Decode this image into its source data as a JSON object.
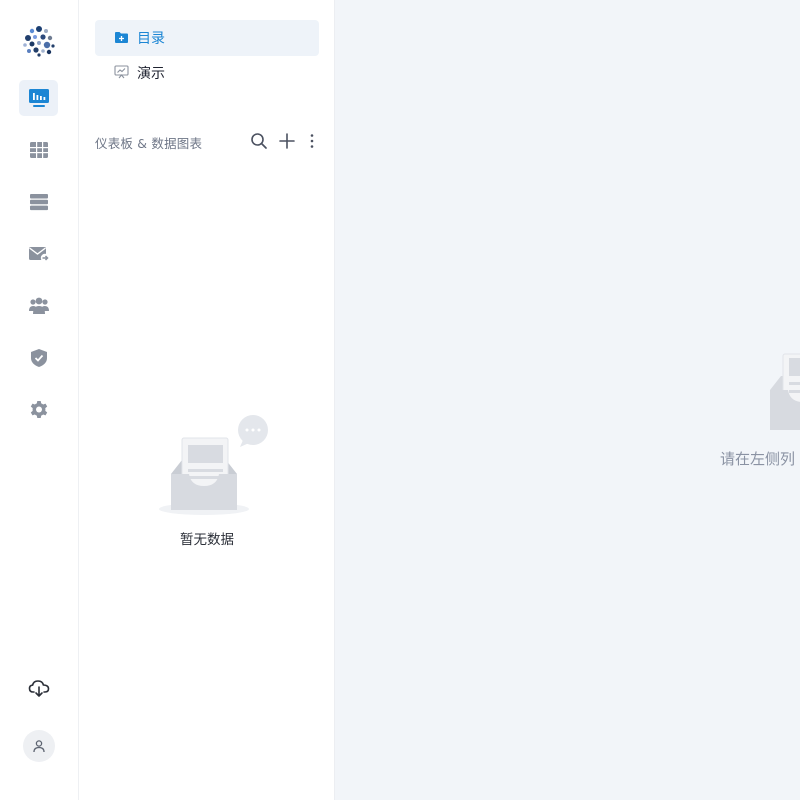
{
  "nav": {
    "items": [
      {
        "label": "目录",
        "icon": "folder-plus-icon",
        "active": true
      },
      {
        "label": "演示",
        "icon": "presentation-icon",
        "active": false
      }
    ]
  },
  "section": {
    "title": "仪表板 & 数据图表"
  },
  "empty": {
    "text": "暂无数据"
  },
  "main": {
    "hint": "请在左侧列"
  },
  "colors": {
    "accent": "#1c86d4",
    "rail_active_bg": "#ecf1f8",
    "icon_gray": "#6b7280",
    "main_bg": "#f2f5f9"
  }
}
